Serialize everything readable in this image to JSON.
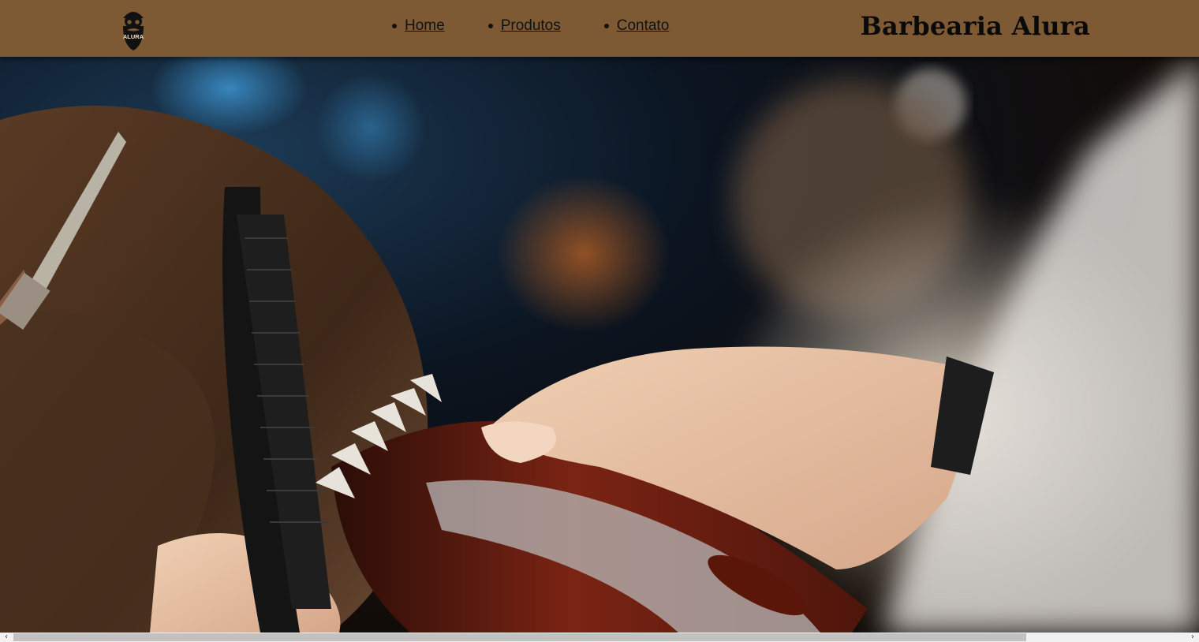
{
  "header": {
    "logo_text": "ALURA",
    "brand": "Barbearia Alura",
    "background_color": "#7d5a33"
  },
  "nav": {
    "items": [
      {
        "label": "Home"
      },
      {
        "label": "Produtos"
      },
      {
        "label": "Contato"
      }
    ]
  },
  "hero": {
    "image": "barber-cutting-hair-with-clipper-and-comb"
  },
  "scrollbar": {
    "left_arrow": "‹",
    "right_arrow": "›"
  }
}
